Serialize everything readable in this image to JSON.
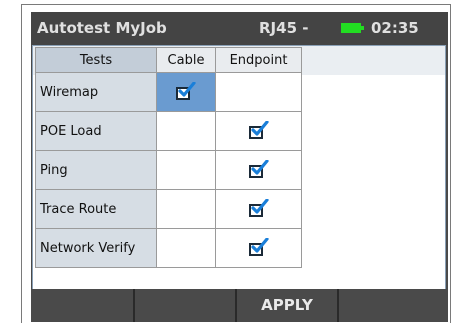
{
  "titlebar": {
    "mode": "Autotest",
    "job": "MyJob",
    "port": "RJ45 -",
    "time": "02:35",
    "battery_color": "#22dd22"
  },
  "table": {
    "headers": [
      "Tests",
      "Cable",
      "Endpoint"
    ],
    "rows": [
      {
        "label": "Wiremap",
        "cable": true,
        "endpoint": false
      },
      {
        "label": "POE Load",
        "cable": false,
        "endpoint": true
      },
      {
        "label": "Ping",
        "cable": false,
        "endpoint": true
      },
      {
        "label": "Trace Route",
        "cable": false,
        "endpoint": true
      },
      {
        "label": "Network Verify",
        "cable": false,
        "endpoint": true
      }
    ],
    "selected_cell_color": "#6a9bd0"
  },
  "softkeys": [
    "",
    "",
    "APPLY",
    ""
  ]
}
